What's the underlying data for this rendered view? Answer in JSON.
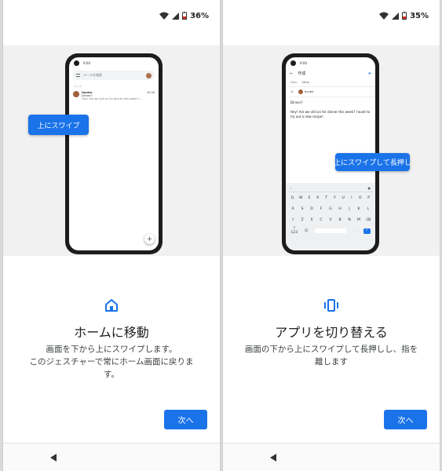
{
  "colors": {
    "accent": "#1a73e8",
    "illustration_bg": "#f1f1f1"
  },
  "left": {
    "status": {
      "battery": "36%"
    },
    "phone": {
      "time": "9:00",
      "search_placeholder": "メールを検索",
      "section": "メイン",
      "mail": {
        "sender": "Hunter",
        "time": "10:30",
        "subject": "Dinner?",
        "snippet": "Hey! Are we still on for dinner this week? I..."
      }
    },
    "tooltip": "上にスワイプ",
    "icon": "home-icon",
    "title": "ホームに移動",
    "description": "画面を下から上にスワイプします。\nこのジェスチャーで常にホーム画面に戻ります。",
    "next_label": "次へ"
  },
  "right": {
    "status": {
      "battery": "35%"
    },
    "phone": {
      "time": "9:00",
      "compose_title": "作成",
      "from_label": "From",
      "from_value": "Chris",
      "to_label": "To",
      "to_value": "Hunter",
      "subject": "Dinner?",
      "body": "Hey! Are we still on for dinner this week? I want to try out a new recipe!",
      "keyboard_rows": [
        [
          "Q",
          "W",
          "E",
          "R",
          "T",
          "Y",
          "U",
          "I",
          "O",
          "P"
        ],
        [
          "A",
          "S",
          "D",
          "F",
          "G",
          "H",
          "J",
          "K",
          "L"
        ],
        [
          "Z",
          "X",
          "C",
          "V",
          "B",
          "N",
          "M"
        ]
      ],
      "mode_key": "?123"
    },
    "tooltip": "上にスワイプして長押し",
    "icon": "app-switch-icon",
    "title": "アプリを切り替える",
    "description": "画面の下から上にスワイプして長押しし、指を離します",
    "next_label": "次へ"
  }
}
